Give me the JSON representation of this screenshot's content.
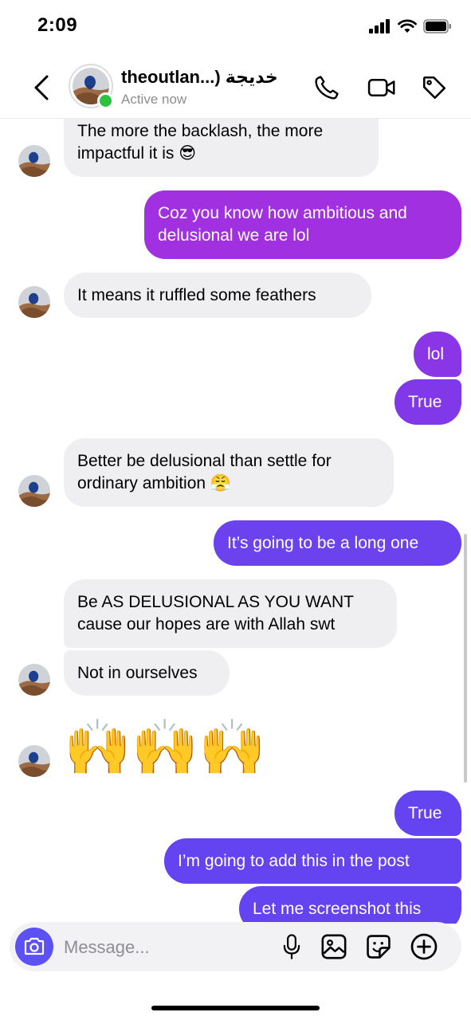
{
  "status_bar": {
    "time": "2:09"
  },
  "header": {
    "contact_name": "theoutlan...) خديجة",
    "contact_status": "Active now"
  },
  "messages": [
    {
      "side": "in",
      "text": [
        "The more the backlash, the more",
        "impactful it is 😎"
      ]
    },
    {
      "side": "out",
      "text": [
        "Coz you know how ambitious and",
        "delusional we are lol"
      ]
    },
    {
      "side": "in",
      "text": [
        "It means it ruffled some feathers"
      ]
    },
    {
      "side": "out",
      "text": [
        "lol"
      ]
    },
    {
      "side": "out",
      "text": [
        "True"
      ]
    },
    {
      "side": "in",
      "text": [
        "Better be delusional than settle for",
        "ordinary ambition 😤"
      ]
    },
    {
      "side": "out",
      "text": [
        "It’s going to be a long one"
      ]
    },
    {
      "side": "in",
      "text": [
        "Be AS DELUSIONAL AS YOU WANT",
        "cause our hopes are with Allah swt"
      ]
    },
    {
      "side": "in",
      "text": [
        "Not in ourselves"
      ]
    },
    {
      "side": "in",
      "text": [
        "🙌🙌🙌"
      ]
    },
    {
      "side": "out",
      "text": [
        "True"
      ]
    },
    {
      "side": "out",
      "text": [
        "I’m going to add this in the post"
      ]
    },
    {
      "side": "out",
      "text": [
        "Let me screenshot this"
      ]
    }
  ],
  "composer": {
    "placeholder": "Message..."
  },
  "icons": {
    "back": "chevron-left-icon",
    "call": "phone-icon",
    "video": "video-camera-icon",
    "tag": "tag-icon",
    "camera": "camera-icon",
    "mic": "microphone-icon",
    "gallery": "image-icon",
    "sticker": "sticker-icon",
    "plus": "plus-circle-icon"
  },
  "colors": {
    "incoming_bubble": "#efeff1",
    "outgoing_purple": "#a030e0",
    "outgoing_violet": "#6443f0",
    "online": "#2cc13f",
    "camera_button": "#5b51f5"
  }
}
